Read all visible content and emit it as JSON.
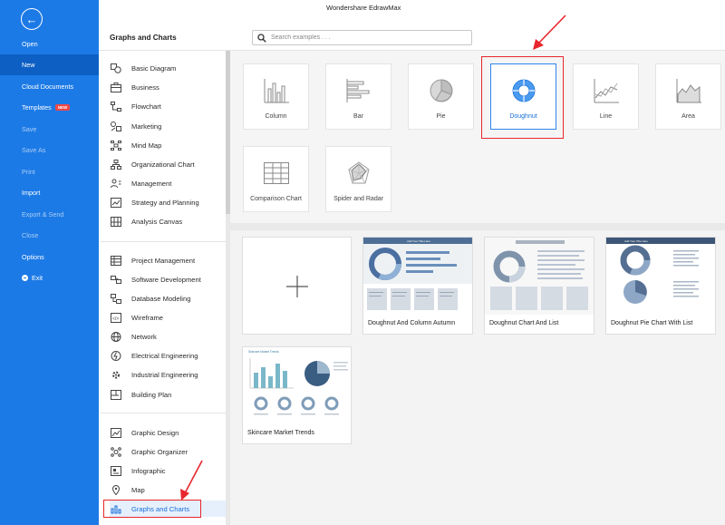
{
  "app_title": "Wondershare EdrawMax",
  "nav": {
    "items": [
      {
        "label": "Open"
      },
      {
        "label": "New"
      },
      {
        "label": "Cloud Documents"
      },
      {
        "label": "Templates",
        "badge": "NEW"
      },
      {
        "label": "Save"
      },
      {
        "label": "Save As"
      },
      {
        "label": "Print"
      },
      {
        "label": "Import"
      },
      {
        "label": "Export & Send"
      },
      {
        "label": "Close"
      },
      {
        "label": "Options"
      },
      {
        "label": "Exit"
      }
    ]
  },
  "section_title": "Graphs and Charts",
  "search": {
    "placeholder": "Search examples . . .",
    "value": ""
  },
  "categories": [
    {
      "label": "Basic Diagram",
      "icon": "shapes-icon"
    },
    {
      "label": "Business",
      "icon": "briefcase-icon"
    },
    {
      "label": "Flowchart",
      "icon": "flowchart-icon"
    },
    {
      "label": "Marketing",
      "icon": "marketing-icon"
    },
    {
      "label": "Mind Map",
      "icon": "mindmap-icon"
    },
    {
      "label": "Organizational Chart",
      "icon": "org-chart-icon"
    },
    {
      "label": "Management",
      "icon": "management-icon"
    },
    {
      "label": "Strategy and Planning",
      "icon": "strategy-icon"
    },
    {
      "label": "Analysis Canvas",
      "icon": "canvas-icon"
    },
    {
      "label": "Project Management",
      "icon": "project-icon"
    },
    {
      "label": "Software Development",
      "icon": "software-icon"
    },
    {
      "label": "Database Modeling",
      "icon": "database-icon"
    },
    {
      "label": "Wireframe",
      "icon": "wireframe-icon"
    },
    {
      "label": "Network",
      "icon": "network-icon"
    },
    {
      "label": "Electrical Engineering",
      "icon": "electrical-icon"
    },
    {
      "label": "Industrial Engineering",
      "icon": "industrial-icon"
    },
    {
      "label": "Building Plan",
      "icon": "building-icon"
    },
    {
      "label": "Graphic Design",
      "icon": "graphic-design-icon"
    },
    {
      "label": "Graphic Organizer",
      "icon": "organizer-icon"
    },
    {
      "label": "Infographic",
      "icon": "infographic-icon"
    },
    {
      "label": "Map",
      "icon": "map-pin-icon"
    },
    {
      "label": "Graphs and Charts",
      "icon": "bar-chart-icon",
      "selected": true
    }
  ],
  "chart_types": [
    {
      "label": "Column"
    },
    {
      "label": "Bar"
    },
    {
      "label": "Pie"
    },
    {
      "label": "Doughnut",
      "selected": true
    },
    {
      "label": "Line"
    },
    {
      "label": "Area"
    },
    {
      "label": "Comparison Chart"
    },
    {
      "label": "Spider and Radar"
    }
  ],
  "templates": [
    {
      "label": ""
    },
    {
      "label": "Doughnut And Column Autumn"
    },
    {
      "label": "Doughnut Chart And List"
    },
    {
      "label": "Doughnut Pie Chart With List"
    },
    {
      "label": "Skincare Market Trends"
    }
  ],
  "template_thumbnail_titles": {
    "t1": "Add Your Title Here",
    "t3": "Add Your Title Here",
    "t4": "Skincare Market Trends"
  },
  "colors": {
    "nav_bg": "#1c7ae6",
    "nav_active": "#0d5fc4",
    "accent": "#2f84ea",
    "highlight_red": "#e8262d",
    "badge": "#f04646"
  }
}
